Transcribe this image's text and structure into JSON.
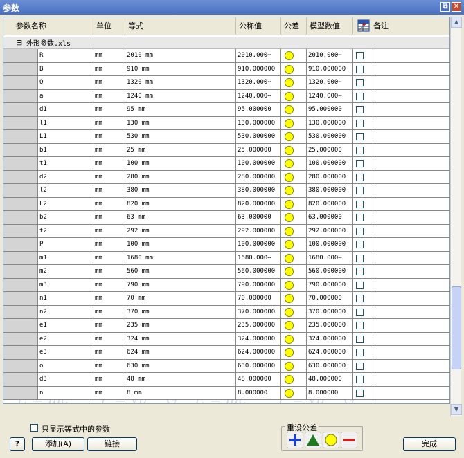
{
  "window": {
    "title": "参数",
    "restore_glyph": "⧉",
    "close_glyph": "✕"
  },
  "columns": {
    "name": "参数名称",
    "unit": "单位",
    "equation": "等式",
    "nominal": "公称值",
    "tolerance": "公差",
    "model_value": "模型数值",
    "comment": "备注"
  },
  "group": {
    "collapse_glyph": "⊟",
    "label": "外形参数.xls"
  },
  "rows": [
    [
      "R",
      "mm",
      "2010 mm",
      "2010.000⋯",
      "2010.000⋯"
    ],
    [
      "B",
      "mm",
      "910 mm",
      "910.000000",
      "910.000000"
    ],
    [
      "O",
      "mm",
      "1320 mm",
      "1320.000⋯",
      "1320.000⋯"
    ],
    [
      "a",
      "mm",
      "1240 mm",
      "1240.000⋯",
      "1240.000⋯"
    ],
    [
      "d1",
      "mm",
      "95 mm",
      "95.000000",
      "95.000000"
    ],
    [
      "l1",
      "mm",
      "130 mm",
      "130.000000",
      "130.000000"
    ],
    [
      "L1",
      "mm",
      "530 mm",
      "530.000000",
      "530.000000"
    ],
    [
      "b1",
      "mm",
      "25 mm",
      "25.000000",
      "25.000000"
    ],
    [
      "t1",
      "mm",
      "100 mm",
      "100.000000",
      "100.000000"
    ],
    [
      "d2",
      "mm",
      "280 mm",
      "280.000000",
      "280.000000"
    ],
    [
      "l2",
      "mm",
      "380 mm",
      "380.000000",
      "380.000000"
    ],
    [
      "L2",
      "mm",
      "820 mm",
      "820.000000",
      "820.000000"
    ],
    [
      "b2",
      "mm",
      "63 mm",
      "63.000000",
      "63.000000"
    ],
    [
      "t2",
      "mm",
      "292 mm",
      "292.000000",
      "292.000000"
    ],
    [
      "P",
      "mm",
      "100 mm",
      "100.000000",
      "100.000000"
    ],
    [
      "m1",
      "mm",
      "1680 mm",
      "1680.000⋯",
      "1680.000⋯"
    ],
    [
      "m2",
      "mm",
      "560 mm",
      "560.000000",
      "560.000000"
    ],
    [
      "m3",
      "mm",
      "790 mm",
      "790.000000",
      "790.000000"
    ],
    [
      "n1",
      "mm",
      "70 mm",
      "70.000000",
      "70.000000"
    ],
    [
      "n2",
      "mm",
      "370 mm",
      "370.000000",
      "370.000000"
    ],
    [
      "e1",
      "mm",
      "235 mm",
      "235.000000",
      "235.000000"
    ],
    [
      "e2",
      "mm",
      "324 mm",
      "324.000000",
      "324.000000"
    ],
    [
      "e3",
      "mm",
      "624 mm",
      "624.000000",
      "624.000000"
    ],
    [
      "o",
      "mm",
      "630 mm",
      "630.000000",
      "630.000000"
    ],
    [
      "d3",
      "mm",
      "48 mm",
      "48.000000",
      "48.000000"
    ],
    [
      "n",
      "mm",
      "8 mm",
      "8.000000",
      "8.000000"
    ]
  ],
  "footer": {
    "checkbox_label": "只显示等式中的参数",
    "help_glyph": "?",
    "add_button": "添加(A)",
    "link_button": "链接",
    "tolerance_group_label": "重设公差",
    "done_button": "完成"
  },
  "icons": {
    "comment_header_icon": "spreadsheet-export-icon",
    "tolerance_dot_icon": "yellow-circle-icon",
    "tol_plus_icon": "plus-icon",
    "tol_triangle_icon": "green-triangle-icon",
    "tol_circle_icon": "yellow-circle-icon",
    "tol_minus_icon": "minus-icon"
  },
  "colors": {
    "title_bar": "#4a6fc0",
    "tolerance_dot": "#ffff00",
    "plus": "#1e40c8",
    "triangle": "#1e7a1e",
    "minus": "#cc1f1f"
  }
}
